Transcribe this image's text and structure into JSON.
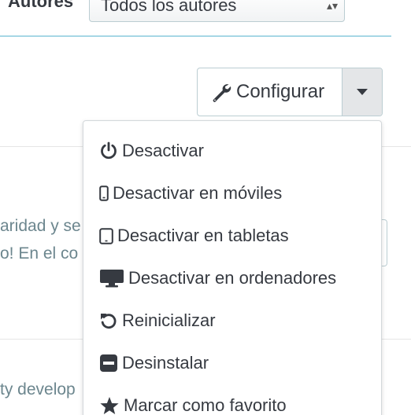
{
  "filter": {
    "label": "Autores",
    "selected": "Todos los autores"
  },
  "configure": {
    "label": "Configurar",
    "icon": "wrench-icon"
  },
  "background": {
    "line1": "aridad y se",
    "line2": "o! En el co",
    "line3": "ty develop"
  },
  "menu": {
    "items": [
      {
        "label": "Desactivar",
        "icon": "power-icon"
      },
      {
        "label": "Desactivar en móviles",
        "icon": "mobile-icon"
      },
      {
        "label": "Desactivar en tabletas",
        "icon": "tablet-icon"
      },
      {
        "label": "Desactivar en ordenadores",
        "icon": "desktop-icon"
      },
      {
        "label": "Reinicializar",
        "icon": "undo-icon"
      },
      {
        "label": "Desinstalar",
        "icon": "minus-square-icon"
      },
      {
        "label": "Marcar como favorito",
        "icon": "star-icon"
      }
    ]
  }
}
